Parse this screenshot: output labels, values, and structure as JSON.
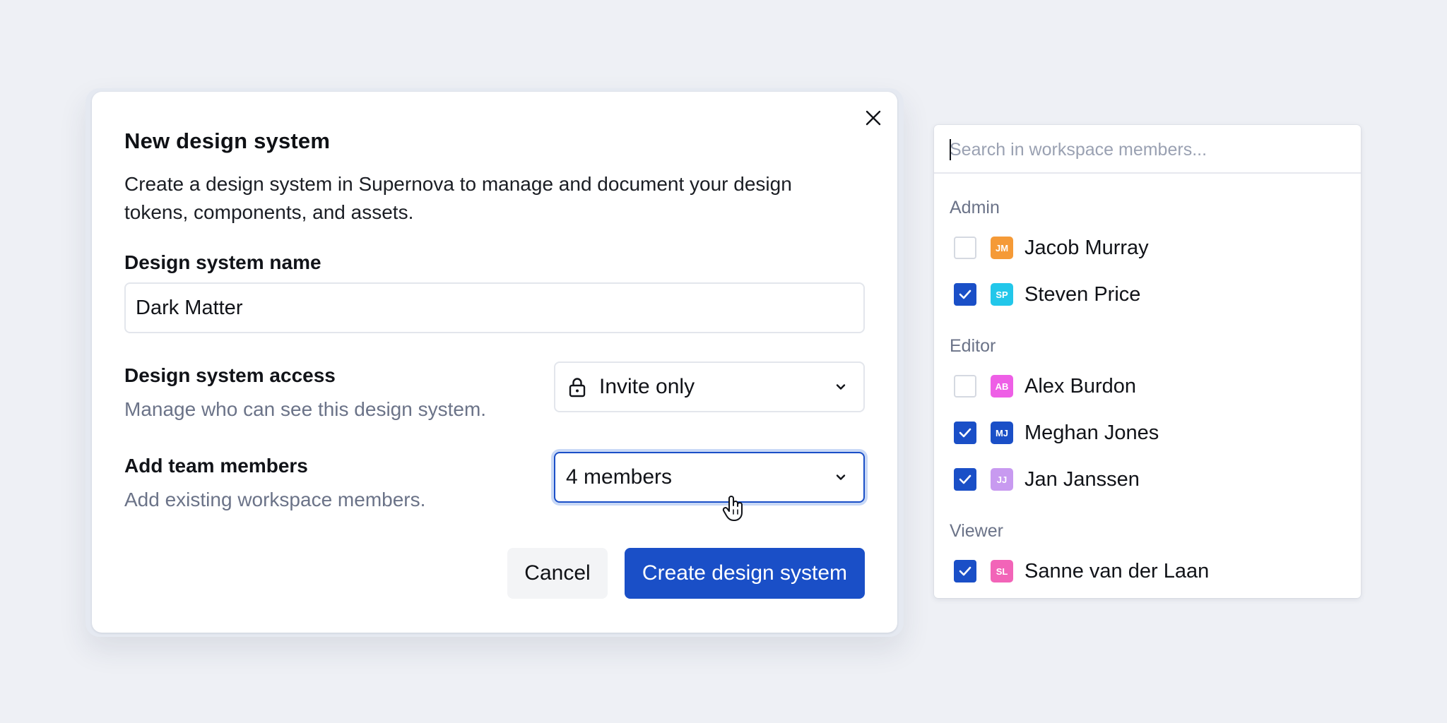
{
  "modal": {
    "title": "New design system",
    "description": "Create a design system in Supernova to manage and document your design tokens, components, and assets.",
    "name_label": "Design system name",
    "name_value": "Dark Matter",
    "access_label": "Design system access",
    "access_help": "Manage who can see this design system.",
    "access_value": "Invite only",
    "members_label": "Add team members",
    "members_help": "Add existing workspace members.",
    "members_value": "4 members",
    "cancel_label": "Cancel",
    "create_label": "Create design system"
  },
  "dropdown": {
    "search_placeholder": "Search in workspace members...",
    "groups": [
      {
        "label": "Admin",
        "members": [
          {
            "name": "Jacob Murray",
            "initials": "JM",
            "checked": false,
            "color": "#f59a37"
          },
          {
            "name": "Steven Price",
            "initials": "SP",
            "checked": true,
            "color": "#22c7ea"
          }
        ]
      },
      {
        "label": "Editor",
        "members": [
          {
            "name": "Alex Burdon",
            "initials": "AB",
            "checked": false,
            "color": "#ee5fe6"
          },
          {
            "name": "Meghan Jones",
            "initials": "MJ",
            "checked": true,
            "color": "#1a4fc7"
          },
          {
            "name": "Jan Janssen",
            "initials": "JJ",
            "checked": true,
            "color": "#c89af0"
          }
        ]
      },
      {
        "label": "Viewer",
        "members": [
          {
            "name": "Sanne van der Laan",
            "initials": "SL",
            "checked": true,
            "color": "#f264b8"
          }
        ]
      }
    ]
  },
  "icons": {
    "close": "close-icon",
    "lock": "lock-icon",
    "chevron": "chevron-down-icon",
    "check": "check-icon",
    "cursor": "hand-pointer-icon"
  },
  "colors": {
    "accent": "#1a4fc7",
    "background": "#eef0f5",
    "muted_text": "#6b7388"
  }
}
